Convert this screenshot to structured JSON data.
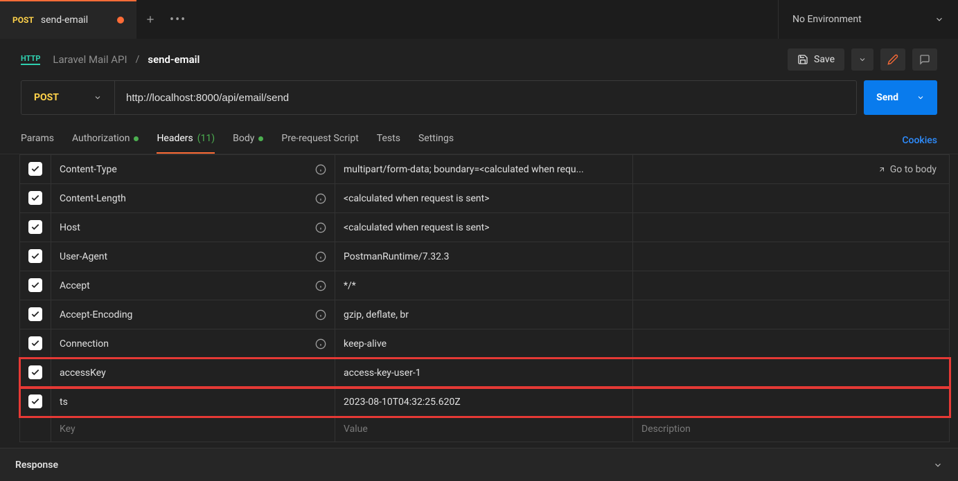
{
  "tab": {
    "method": "POST",
    "name": "send-email"
  },
  "environment": {
    "label": "No Environment"
  },
  "breadcrumb": {
    "collection": "Laravel Mail API",
    "request": "send-email"
  },
  "toolbar": {
    "save_label": "Save"
  },
  "url_bar": {
    "method": "POST",
    "url": "http://localhost:8000/api/email/send",
    "send_label": "Send"
  },
  "subtabs": {
    "params": "Params",
    "authorization": "Authorization",
    "headers": "Headers",
    "headers_count": "(11)",
    "body": "Body",
    "prerequest": "Pre-request Script",
    "tests": "Tests",
    "settings": "Settings",
    "cookies": "Cookies"
  },
  "headers_table": {
    "go_to_body": "Go to body",
    "placeholders": {
      "key": "Key",
      "value": "Value",
      "description": "Description"
    },
    "rows": [
      {
        "key": "Content-Type",
        "value": "multipart/form-data; boundary=<calculated when requ...",
        "info": true
      },
      {
        "key": "Content-Length",
        "value": "<calculated when request is sent>",
        "info": true
      },
      {
        "key": "Host",
        "value": "<calculated when request is sent>",
        "info": true
      },
      {
        "key": "User-Agent",
        "value": "PostmanRuntime/7.32.3",
        "info": true
      },
      {
        "key": "Accept",
        "value": "*/*",
        "info": true
      },
      {
        "key": "Accept-Encoding",
        "value": "gzip, deflate, br",
        "info": true
      },
      {
        "key": "Connection",
        "value": "keep-alive",
        "info": true
      },
      {
        "key": "accessKey",
        "value": "access-key-user-1",
        "info": false,
        "highlight": true
      },
      {
        "key": "ts",
        "value": "2023-08-10T04:32:25.620Z",
        "info": false,
        "highlight": true
      }
    ]
  },
  "response": {
    "label": "Response"
  }
}
